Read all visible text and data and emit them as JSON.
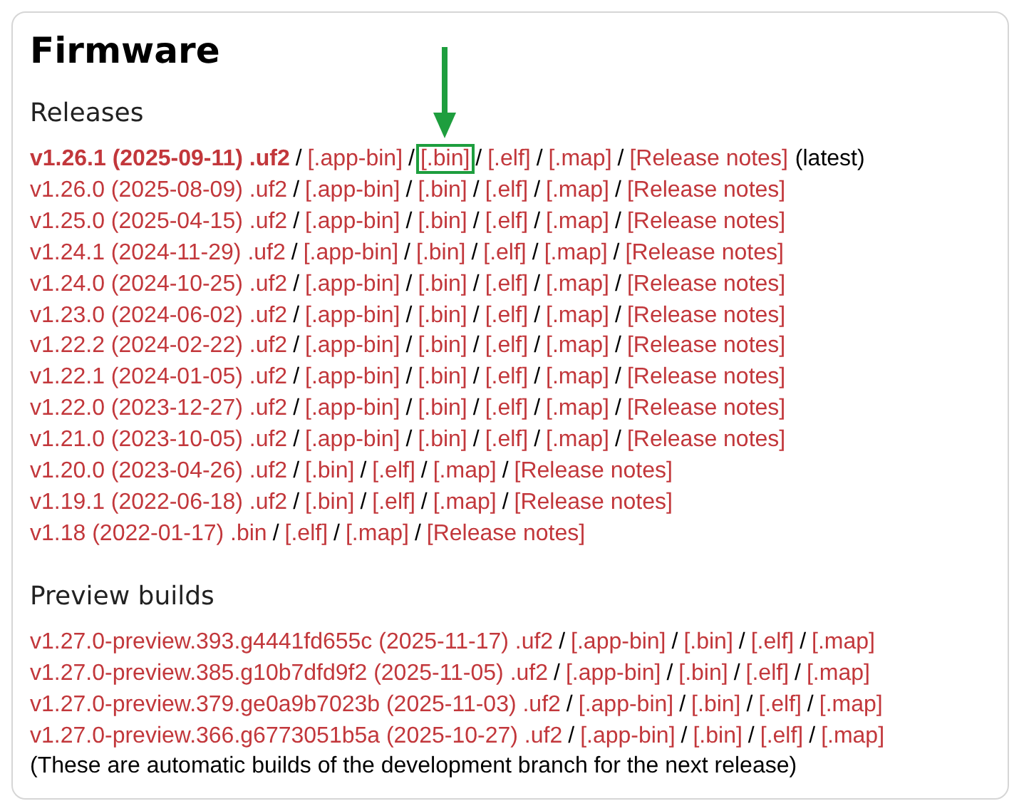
{
  "title": "Firmware",
  "separator": "/",
  "releases": {
    "heading": "Releases",
    "items": [
      {
        "version": "v1.26.1 (2025-09-11) .uf2",
        "latest": true,
        "note": "(latest)",
        "links": [
          {
            "text": "[.app-bin]",
            "highlighted": false
          },
          {
            "text": "[.bin]",
            "highlighted": true
          },
          {
            "text": "[.elf]",
            "highlighted": false
          },
          {
            "text": "[.map]",
            "highlighted": false
          },
          {
            "text": "[Release notes]",
            "highlighted": false
          }
        ]
      },
      {
        "version": "v1.26.0 (2025-08-09) .uf2",
        "latest": false,
        "links": [
          {
            "text": "[.app-bin]",
            "highlighted": false
          },
          {
            "text": "[.bin]",
            "highlighted": false
          },
          {
            "text": "[.elf]",
            "highlighted": false
          },
          {
            "text": "[.map]",
            "highlighted": false
          },
          {
            "text": "[Release notes]",
            "highlighted": false
          }
        ]
      },
      {
        "version": "v1.25.0 (2025-04-15) .uf2",
        "latest": false,
        "links": [
          {
            "text": "[.app-bin]",
            "highlighted": false
          },
          {
            "text": "[.bin]",
            "highlighted": false
          },
          {
            "text": "[.elf]",
            "highlighted": false
          },
          {
            "text": "[.map]",
            "highlighted": false
          },
          {
            "text": "[Release notes]",
            "highlighted": false
          }
        ]
      },
      {
        "version": "v1.24.1 (2024-11-29) .uf2",
        "latest": false,
        "links": [
          {
            "text": "[.app-bin]",
            "highlighted": false
          },
          {
            "text": "[.bin]",
            "highlighted": false
          },
          {
            "text": "[.elf]",
            "highlighted": false
          },
          {
            "text": "[.map]",
            "highlighted": false
          },
          {
            "text": "[Release notes]",
            "highlighted": false
          }
        ]
      },
      {
        "version": "v1.24.0 (2024-10-25) .uf2",
        "latest": false,
        "links": [
          {
            "text": "[.app-bin]",
            "highlighted": false
          },
          {
            "text": "[.bin]",
            "highlighted": false
          },
          {
            "text": "[.elf]",
            "highlighted": false
          },
          {
            "text": "[.map]",
            "highlighted": false
          },
          {
            "text": "[Release notes]",
            "highlighted": false
          }
        ]
      },
      {
        "version": "v1.23.0 (2024-06-02) .uf2",
        "latest": false,
        "links": [
          {
            "text": "[.app-bin]",
            "highlighted": false
          },
          {
            "text": "[.bin]",
            "highlighted": false
          },
          {
            "text": "[.elf]",
            "highlighted": false
          },
          {
            "text": "[.map]",
            "highlighted": false
          },
          {
            "text": "[Release notes]",
            "highlighted": false
          }
        ]
      },
      {
        "version": "v1.22.2 (2024-02-22) .uf2",
        "latest": false,
        "links": [
          {
            "text": "[.app-bin]",
            "highlighted": false
          },
          {
            "text": "[.bin]",
            "highlighted": false
          },
          {
            "text": "[.elf]",
            "highlighted": false
          },
          {
            "text": "[.map]",
            "highlighted": false
          },
          {
            "text": "[Release notes]",
            "highlighted": false
          }
        ]
      },
      {
        "version": "v1.22.1 (2024-01-05) .uf2",
        "latest": false,
        "links": [
          {
            "text": "[.app-bin]",
            "highlighted": false
          },
          {
            "text": "[.bin]",
            "highlighted": false
          },
          {
            "text": "[.elf]",
            "highlighted": false
          },
          {
            "text": "[.map]",
            "highlighted": false
          },
          {
            "text": "[Release notes]",
            "highlighted": false
          }
        ]
      },
      {
        "version": "v1.22.0 (2023-12-27) .uf2",
        "latest": false,
        "links": [
          {
            "text": "[.app-bin]",
            "highlighted": false
          },
          {
            "text": "[.bin]",
            "highlighted": false
          },
          {
            "text": "[.elf]",
            "highlighted": false
          },
          {
            "text": "[.map]",
            "highlighted": false
          },
          {
            "text": "[Release notes]",
            "highlighted": false
          }
        ]
      },
      {
        "version": "v1.21.0 (2023-10-05) .uf2",
        "latest": false,
        "links": [
          {
            "text": "[.app-bin]",
            "highlighted": false
          },
          {
            "text": "[.bin]",
            "highlighted": false
          },
          {
            "text": "[.elf]",
            "highlighted": false
          },
          {
            "text": "[.map]",
            "highlighted": false
          },
          {
            "text": "[Release notes]",
            "highlighted": false
          }
        ]
      },
      {
        "version": "v1.20.0 (2023-04-26) .uf2",
        "latest": false,
        "links": [
          {
            "text": "[.bin]",
            "highlighted": false
          },
          {
            "text": "[.elf]",
            "highlighted": false
          },
          {
            "text": "[.map]",
            "highlighted": false
          },
          {
            "text": "[Release notes]",
            "highlighted": false
          }
        ]
      },
      {
        "version": "v1.19.1 (2022-06-18) .uf2",
        "latest": false,
        "links": [
          {
            "text": "[.bin]",
            "highlighted": false
          },
          {
            "text": "[.elf]",
            "highlighted": false
          },
          {
            "text": "[.map]",
            "highlighted": false
          },
          {
            "text": "[Release notes]",
            "highlighted": false
          }
        ]
      },
      {
        "version": "v1.18 (2022-01-17) .bin",
        "latest": false,
        "links": [
          {
            "text": "[.elf]",
            "highlighted": false
          },
          {
            "text": "[.map]",
            "highlighted": false
          },
          {
            "text": "[Release notes]",
            "highlighted": false
          }
        ]
      }
    ]
  },
  "preview": {
    "heading": "Preview builds",
    "items": [
      {
        "version": "v1.27.0-preview.393.g4441fd655c (2025-11-17) .uf2",
        "latest": false,
        "links": [
          {
            "text": "[.app-bin]",
            "highlighted": false
          },
          {
            "text": "[.bin]",
            "highlighted": false
          },
          {
            "text": "[.elf]",
            "highlighted": false
          },
          {
            "text": "[.map]",
            "highlighted": false
          }
        ]
      },
      {
        "version": "v1.27.0-preview.385.g10b7dfd9f2 (2025-11-05) .uf2",
        "latest": false,
        "links": [
          {
            "text": "[.app-bin]",
            "highlighted": false
          },
          {
            "text": "[.bin]",
            "highlighted": false
          },
          {
            "text": "[.elf]",
            "highlighted": false
          },
          {
            "text": "[.map]",
            "highlighted": false
          }
        ]
      },
      {
        "version": "v1.27.0-preview.379.ge0a9b7023b (2025-11-03) .uf2",
        "latest": false,
        "links": [
          {
            "text": "[.app-bin]",
            "highlighted": false
          },
          {
            "text": "[.bin]",
            "highlighted": false
          },
          {
            "text": "[.elf]",
            "highlighted": false
          },
          {
            "text": "[.map]",
            "highlighted": false
          }
        ]
      },
      {
        "version": "v1.27.0-preview.366.g6773051b5a (2025-10-27) .uf2",
        "latest": false,
        "links": [
          {
            "text": "[.app-bin]",
            "highlighted": false
          },
          {
            "text": "[.bin]",
            "highlighted": false
          },
          {
            "text": "[.elf]",
            "highlighted": false
          },
          {
            "text": "[.map]",
            "highlighted": false
          }
        ]
      }
    ],
    "footnote": "(These are automatic builds of the development branch for the next release)"
  }
}
